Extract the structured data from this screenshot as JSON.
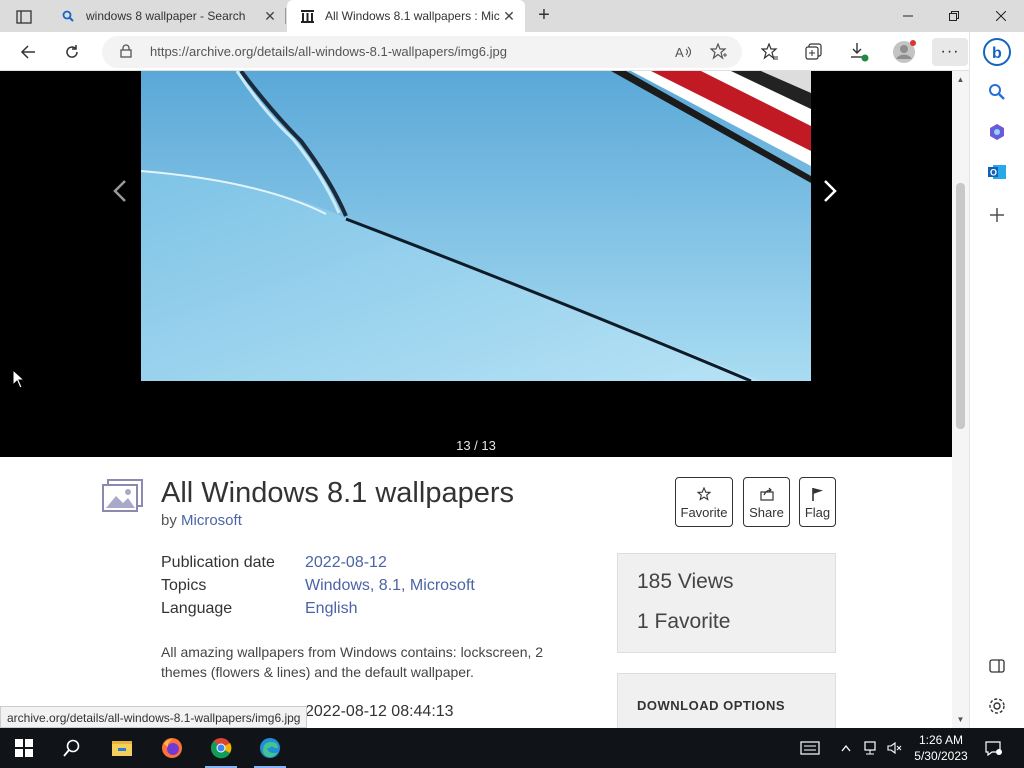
{
  "browser": {
    "tabs": [
      {
        "label": "windows 8 wallpaper - Search",
        "icon": "search-icon"
      },
      {
        "label": "All Windows 8.1 wallpapers : Mic",
        "icon": "archive-icon"
      }
    ],
    "url": "https://archive.org/details/all-windows-8.1-wallpapers/img6.jpg",
    "status_url": "archive.org/details/all-windows-8.1-wallpapers/img6.jpg"
  },
  "viewer": {
    "counter": "13 / 13"
  },
  "item": {
    "title": "All Windows 8.1 wallpapers",
    "by_label": "by",
    "author": "Microsoft",
    "actions": {
      "favorite": "Favorite",
      "share": "Share",
      "flag": "Flag"
    },
    "metadata": [
      {
        "key": "Publication date",
        "value": "2022-08-12"
      },
      {
        "key": "Topics",
        "value": "Windows, 8.1, Microsoft"
      },
      {
        "key": "Language",
        "value": "English"
      }
    ],
    "description": "All amazing wallpapers from Windows contains: lockscreen, 2 themes (flowers & lines) and the default wallpaper.",
    "added_date": "2022-08-12 08:44:13",
    "stats": {
      "views": "185 Views",
      "favorites": "1 Favorite"
    },
    "download_label": "DOWNLOAD OPTIONS"
  },
  "taskbar": {
    "time": "1:26 AM",
    "date": "5/30/2023"
  },
  "colors": {
    "link": "#4b64a6",
    "viewer_bg": "#000000",
    "taskbar_bg": "#101418"
  }
}
